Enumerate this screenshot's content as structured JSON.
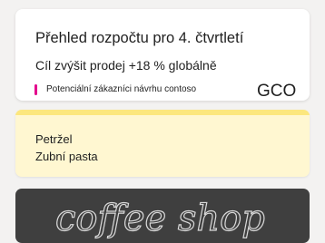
{
  "note": {
    "title": "Přehled rozpočtu pro 4. čtvrtletí",
    "body": "Cíl zvýšit prodej +18 % globálně",
    "tag_text": "Potenciální zákazníci návrhu contoso",
    "handwriting": "GCO"
  },
  "list_note": {
    "items": [
      "Petržel",
      "Zubní pasta"
    ]
  },
  "image_note": {
    "text": "coffee shop"
  },
  "colors": {
    "background": "#f3f2f1",
    "tag_accent": "#e3008c",
    "yellow_note": "#fff7d1",
    "yellow_strip": "#fce77e",
    "chalkboard": "#3f3f3f"
  }
}
